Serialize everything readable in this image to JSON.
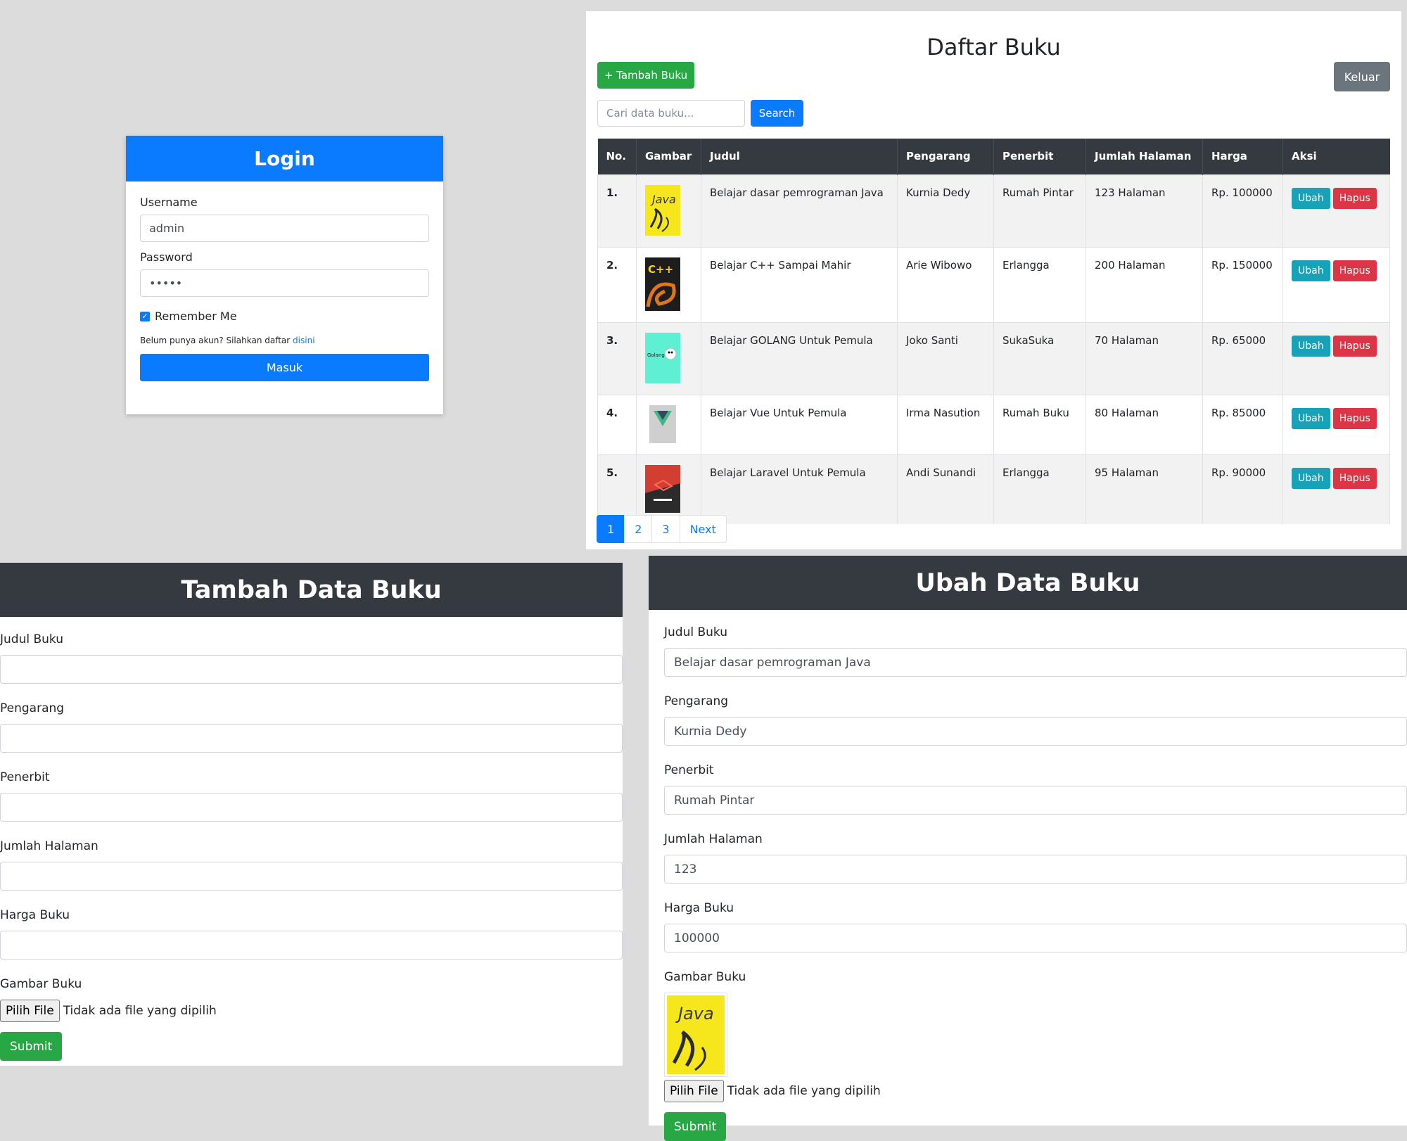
{
  "login": {
    "title": "Login",
    "username_label": "Username",
    "username_value": "admin",
    "password_label": "Password",
    "password_value": "•••••",
    "remember_label": "Remember Me",
    "register_text": "Belum punya akun? Silahkan daftar",
    "register_link": "disini",
    "submit_label": "Masuk"
  },
  "daftar": {
    "title": "Daftar Buku",
    "add_button": "+ Tambah Buku",
    "logout_button": "Keluar",
    "search_placeholder": "Cari data buku...",
    "search_button": "Search",
    "columns": [
      "No.",
      "Gambar",
      "Judul",
      "Pengarang",
      "Penerbit",
      "Jumlah Halaman",
      "Harga",
      "Aksi"
    ],
    "rows": [
      {
        "no": "1.",
        "judul": "Belajar dasar pemrograman Java",
        "pengarang": "Kurnia Dedy",
        "penerbit": "Rumah Pintar",
        "halaman": "123 Halaman",
        "harga": "Rp. 100000",
        "cover": "java-cover"
      },
      {
        "no": "2.",
        "judul": "Belajar C++ Sampai Mahir",
        "pengarang": "Arie Wibowo",
        "penerbit": "Erlangga",
        "halaman": "200 Halaman",
        "harga": "Rp. 150000",
        "cover": "cpp-cover"
      },
      {
        "no": "3.",
        "judul": "Belajar GOLANG Untuk Pemula",
        "pengarang": "Joko Santi",
        "penerbit": "SukaSuka",
        "halaman": "70 Halaman",
        "harga": "Rp. 65000",
        "cover": "golang-cover"
      },
      {
        "no": "4.",
        "judul": "Belajar Vue Untuk Pemula",
        "pengarang": "Irma Nasution",
        "penerbit": "Rumah Buku",
        "halaman": "80 Halaman",
        "harga": "Rp. 85000",
        "cover": "vue-cover"
      },
      {
        "no": "5.",
        "judul": "Belajar Laravel Untuk Pemula",
        "pengarang": "Andi Sunandi",
        "penerbit": "Erlangga",
        "halaman": "95 Halaman",
        "harga": "Rp. 90000",
        "cover": "laravel-cover"
      }
    ],
    "edit_label": "Ubah",
    "delete_label": "Hapus",
    "pagination": [
      "1",
      "2",
      "3",
      "Next"
    ]
  },
  "tambah": {
    "title": "Tambah Data Buku",
    "labels": [
      "Judul Buku",
      "Pengarang",
      "Penerbit",
      "Jumlah Halaman",
      "Harga Buku"
    ],
    "image_label": "Gambar Buku",
    "file_button": "Pilih File",
    "file_status": "Tidak ada file yang dipilih",
    "submit": "Submit"
  },
  "ubah": {
    "title": "Ubah Data Buku",
    "fields": [
      {
        "label": "Judul Buku",
        "value": "Belajar dasar pemrograman Java"
      },
      {
        "label": "Pengarang",
        "value": "Kurnia Dedy"
      },
      {
        "label": "Penerbit",
        "value": "Rumah Pintar"
      },
      {
        "label": "Jumlah Halaman",
        "value": "123"
      },
      {
        "label": "Harga Buku",
        "value": "100000"
      }
    ],
    "image_label": "Gambar Buku",
    "file_button": "Pilih File",
    "file_status": "Tidak ada file yang dipilih",
    "submit": "Submit"
  },
  "colors": {
    "primary": "#0a7bfe",
    "success": "#28a745",
    "info": "#17a2b8",
    "danger": "#dc3545",
    "secondary": "#6c757d",
    "dark": "#343a40",
    "background": "#dcdcdc"
  }
}
